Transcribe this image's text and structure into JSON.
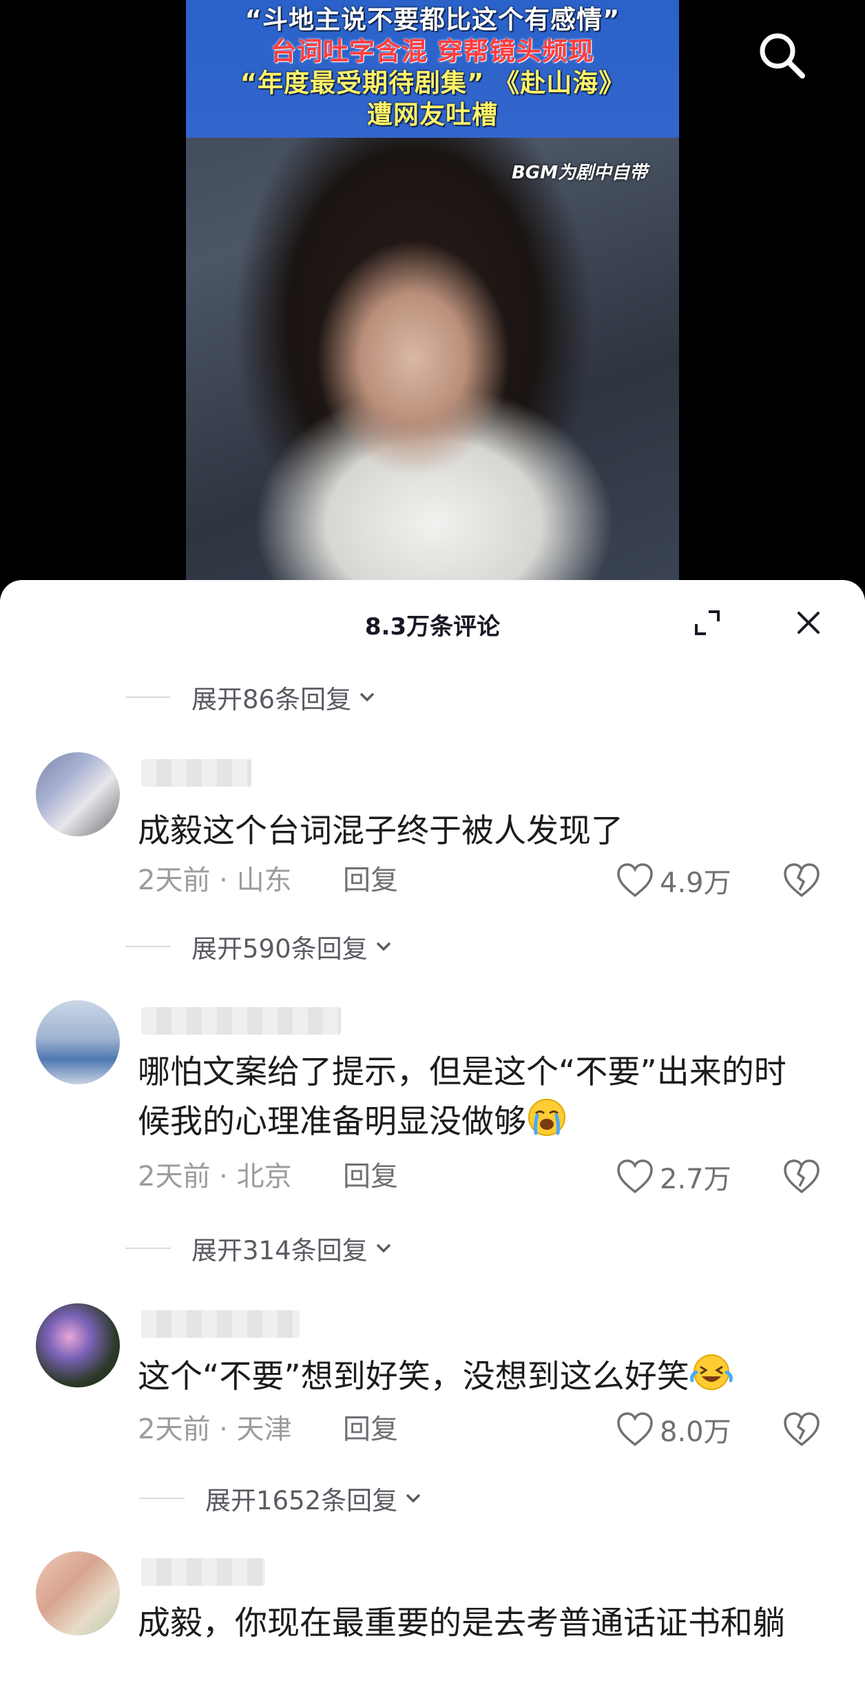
{
  "video": {
    "banner_lines": [
      "“斗地主说不要都比这个有感情”",
      "台词吐字含混 穿帮镜头频现",
      "“年度最受期待剧集” 《赴山海》",
      "遭网友吐槽"
    ],
    "bgm_tag": "BGM为剧中自带",
    "search_icon": "search-icon"
  },
  "sheet": {
    "title": "8.3万条评论",
    "expand_icon": "fullscreen-icon",
    "close_icon": "close-icon"
  },
  "expand_replies": [
    "展开86条回复",
    "展开590条回复",
    "展开314条回复",
    "展开1652条回复"
  ],
  "comments": [
    {
      "text": "成毅这个台词混子终于被人发现了",
      "time": "2天前 · 山东",
      "reply": "回复",
      "likes": "4.9万"
    },
    {
      "text_line1": "哪怕文案给了提示，但是这个“不要”出来的时",
      "text_line2": "候我的心理准备明显没做够",
      "emoji": "loudly-crying-emoji",
      "time": "2天前 · 北京",
      "reply": "回复",
      "likes": "2.7万"
    },
    {
      "text": "这个“不要”想到好笑，没想到这么好笑",
      "emoji": "crying-laughing-emoji",
      "time": "2天前 · 天津",
      "reply": "回复",
      "likes": "8.0万"
    },
    {
      "text": "成毅，你现在最重要的是去考普通话证书和躺"
    }
  ]
}
